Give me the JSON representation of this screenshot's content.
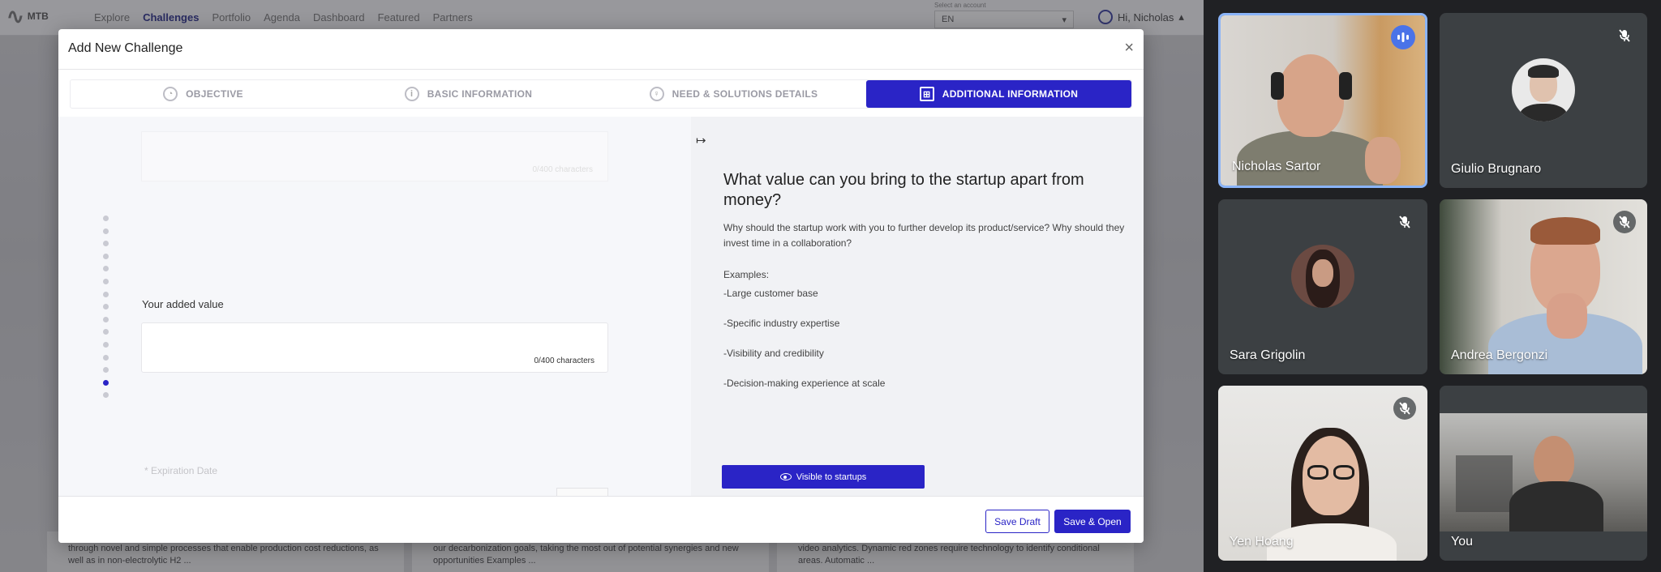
{
  "app": {
    "logo_text": "MTB",
    "nav": [
      "Explore",
      "Challenges",
      "Portfolio",
      "Agenda",
      "Dashboard",
      "Featured",
      "Partners"
    ],
    "active_nav": "Challenges",
    "language_caption": "Select an account",
    "language_value": "EN",
    "user_greeting": "Hi, Nicholas"
  },
  "background_cards": [
    "through novel and simple processes that enable production cost reductions, as well as in non-electrolytic H2 ...",
    "our decarbonization goals, taking the most out of potential synergies and new opportunities Examples ...",
    "video analytics. Dynamic red zones require technology to identify conditional areas. Automatic ..."
  ],
  "modal": {
    "title": "Add New Challenge",
    "close_glyph": "×",
    "steps": [
      {
        "label": "OBJECTIVE",
        "icon": "objective-icon",
        "glyph": "◔",
        "active": false
      },
      {
        "label": "BASIC INFORMATION",
        "icon": "info-icon",
        "glyph": "i",
        "active": false
      },
      {
        "label": "NEED & SOLUTIONS DETAILS",
        "icon": "lightbulb-icon",
        "glyph": "♀",
        "active": false
      },
      {
        "label": "ADDITIONAL INFORMATION",
        "icon": "grid-plus-icon",
        "glyph": "⊞",
        "active": true
      }
    ],
    "previous_field_count": "0/400 characters",
    "field_label": "Your added value",
    "field_value": "",
    "field_count": "0/400 characters",
    "expiration_label": "* Expiration Date",
    "section_dots_total": 15,
    "section_dots_active_index": 13,
    "help": {
      "collapse_glyph": "↦",
      "title": "What value can you bring to the startup apart from money?",
      "description": "Why should the startup work with you to further develop its product/service? Why should they invest time in a collaboration?",
      "examples_title": "Examples:",
      "examples": [
        "-Large customer base",
        "-Specific industry expertise",
        "-Visibility and credibility",
        "-Decision-making experience at scale"
      ],
      "visible_button": "Visible to startups"
    },
    "footer": {
      "save_draft": "Save Draft",
      "save_open": "Save & Open"
    }
  },
  "participants": [
    {
      "name": "Nicholas Sartor",
      "speaking": true,
      "muted": false
    },
    {
      "name": "Giulio Brugnaro",
      "speaking": false,
      "muted": true
    },
    {
      "name": "Sara Grigolin",
      "speaking": false,
      "muted": true
    },
    {
      "name": "Andrea Bergonzi",
      "speaking": false,
      "muted": true
    },
    {
      "name": "Yen Hoang",
      "speaking": false,
      "muted": true
    },
    {
      "name": "You",
      "speaking": false,
      "muted": false
    }
  ],
  "colors": {
    "brand_blue": "#2a24c6",
    "meet_bg": "#202124",
    "tile_bg": "#3c4043",
    "speaking_border": "#8ab4f8"
  }
}
